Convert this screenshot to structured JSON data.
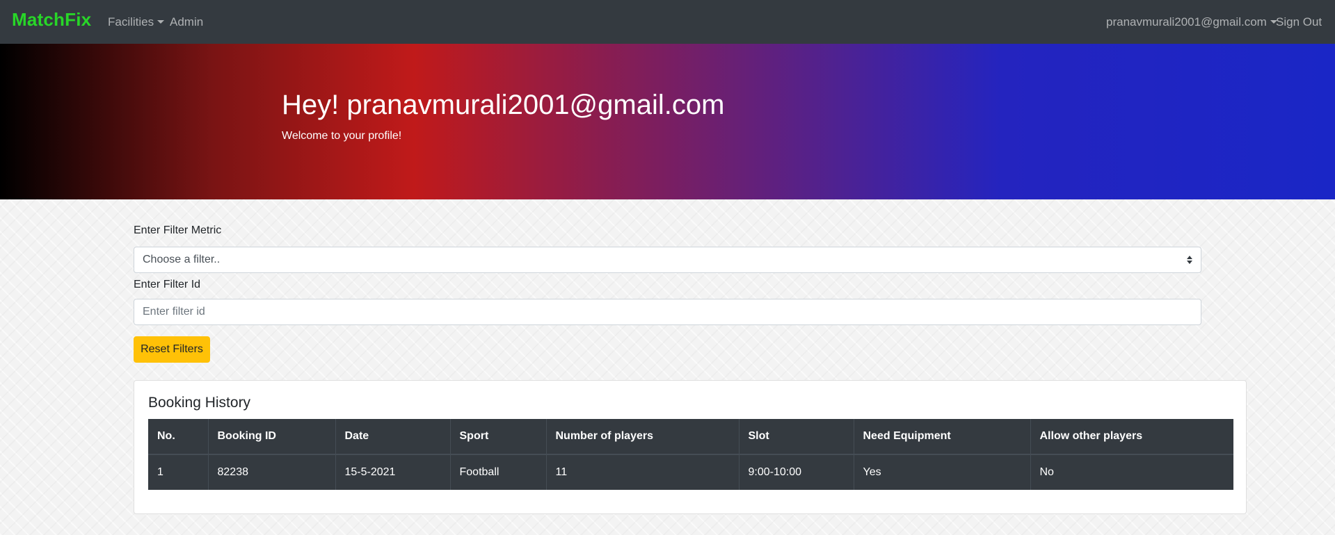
{
  "navbar": {
    "brand": "MatchFix",
    "brand_color": "#28d628",
    "facilities_label": "Facilities",
    "admin_label": "Admin",
    "user_email": "pranavmurali2001@gmail.com",
    "sign_out_label": "Sign Out",
    "background_color": "#343a40"
  },
  "hero": {
    "title": "Hey! pranavmurali2001@gmail.com",
    "subtitle": "Welcome to your profile!"
  },
  "filters": {
    "metric_label": "Enter Filter Metric",
    "metric_selected": "Choose a filter..",
    "id_label": "Enter Filter Id",
    "id_placeholder": "Enter filter id",
    "reset_label": "Reset Filters",
    "reset_color": "#ffc107"
  },
  "booking_history": {
    "title": "Booking History",
    "columns": [
      "No.",
      "Booking ID",
      "Date",
      "Sport",
      "Number of players",
      "Slot",
      "Need Equipment",
      "Allow other players"
    ],
    "rows": [
      [
        "1",
        "82238",
        "15-5-2021",
        "Football",
        "11",
        "9:00-10:00",
        "Yes",
        "No"
      ]
    ]
  }
}
